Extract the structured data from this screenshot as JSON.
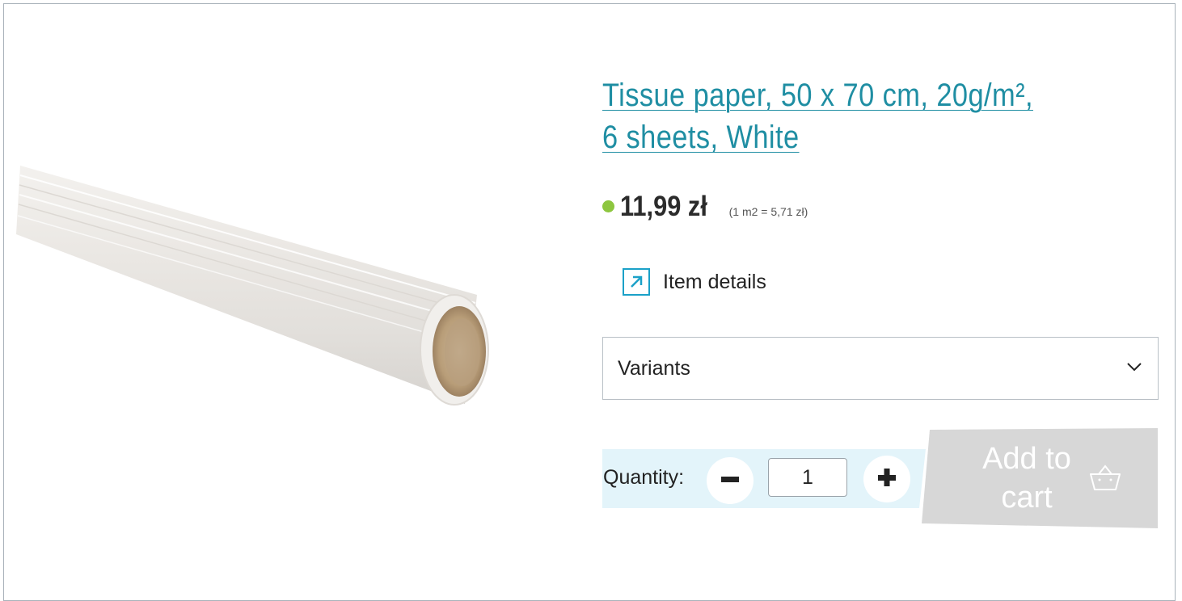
{
  "product": {
    "title": "Tissue paper, 50 x 70 cm, 20g/m², 6 sheets, White",
    "price": "11,99 zł",
    "unit_price": "(1 m2 = 5,71 zł)",
    "availability_color": "#8dc63f",
    "image_icon": "paper-roll-image"
  },
  "details": {
    "label": "Item details",
    "icon": "external-arrow-icon"
  },
  "variants": {
    "label": "Variants",
    "icon": "chevron-down-icon"
  },
  "quantity": {
    "label": "Quantity:",
    "value": "1",
    "minus_icon": "minus-icon",
    "plus_icon": "plus-icon"
  },
  "cart": {
    "label": "Add to cart",
    "icon": "basket-icon"
  },
  "colors": {
    "title_link": "#1f8ea3",
    "accent": "#1ba1c8",
    "quantity_band": "#e3f4fa",
    "cart_button": "#d7d7d7"
  }
}
